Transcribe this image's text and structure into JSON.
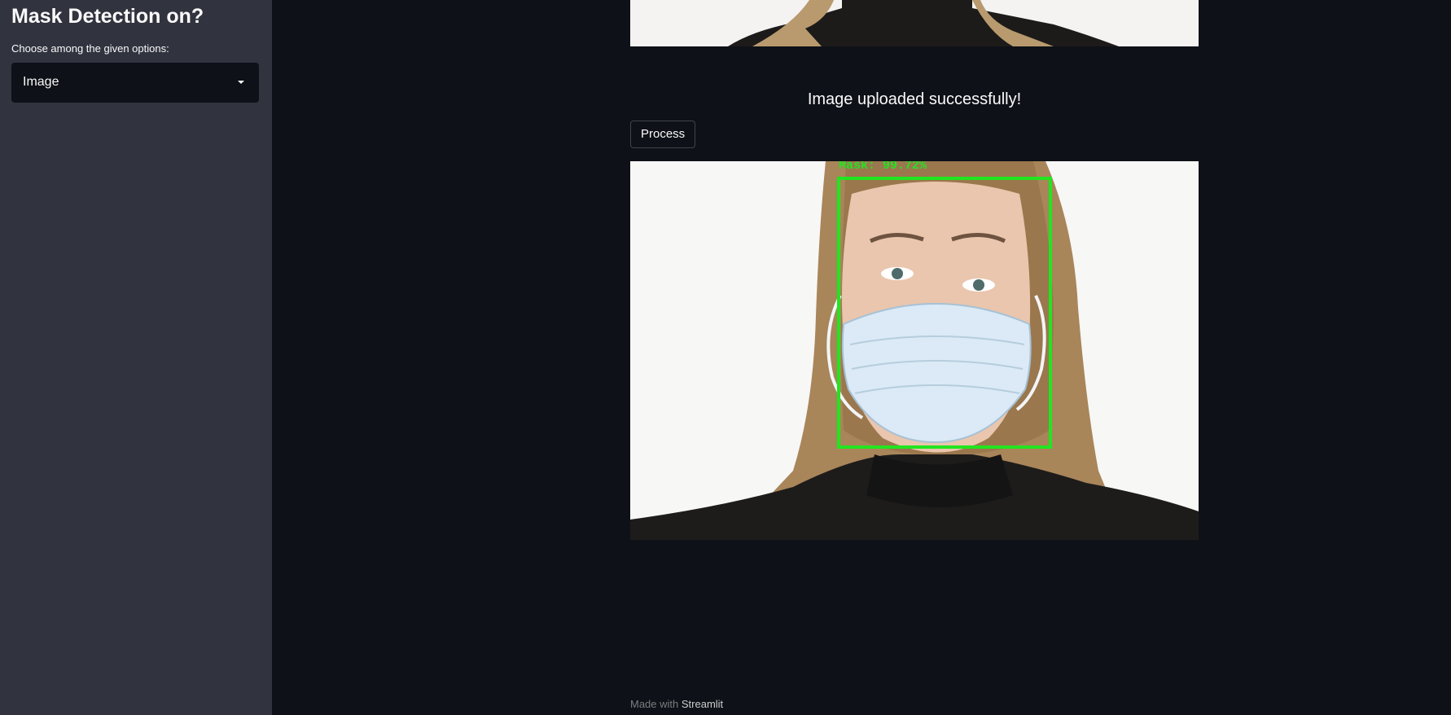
{
  "sidebar": {
    "title": "Mask Detection on?",
    "select_label": "Choose among the given options:",
    "select_value": "Image"
  },
  "main": {
    "success_message": "Image uploaded successfully!",
    "process_button": "Process",
    "detection_label": "Mask: 99.72%"
  },
  "footer": {
    "prefix": "Made with",
    "brand": "Streamlit"
  },
  "colors": {
    "app_background": "#0e1117",
    "sidebar_background": "#31333f",
    "detection_box": "#22e51f"
  },
  "icons": {
    "select_caret": "caret-down-icon"
  }
}
